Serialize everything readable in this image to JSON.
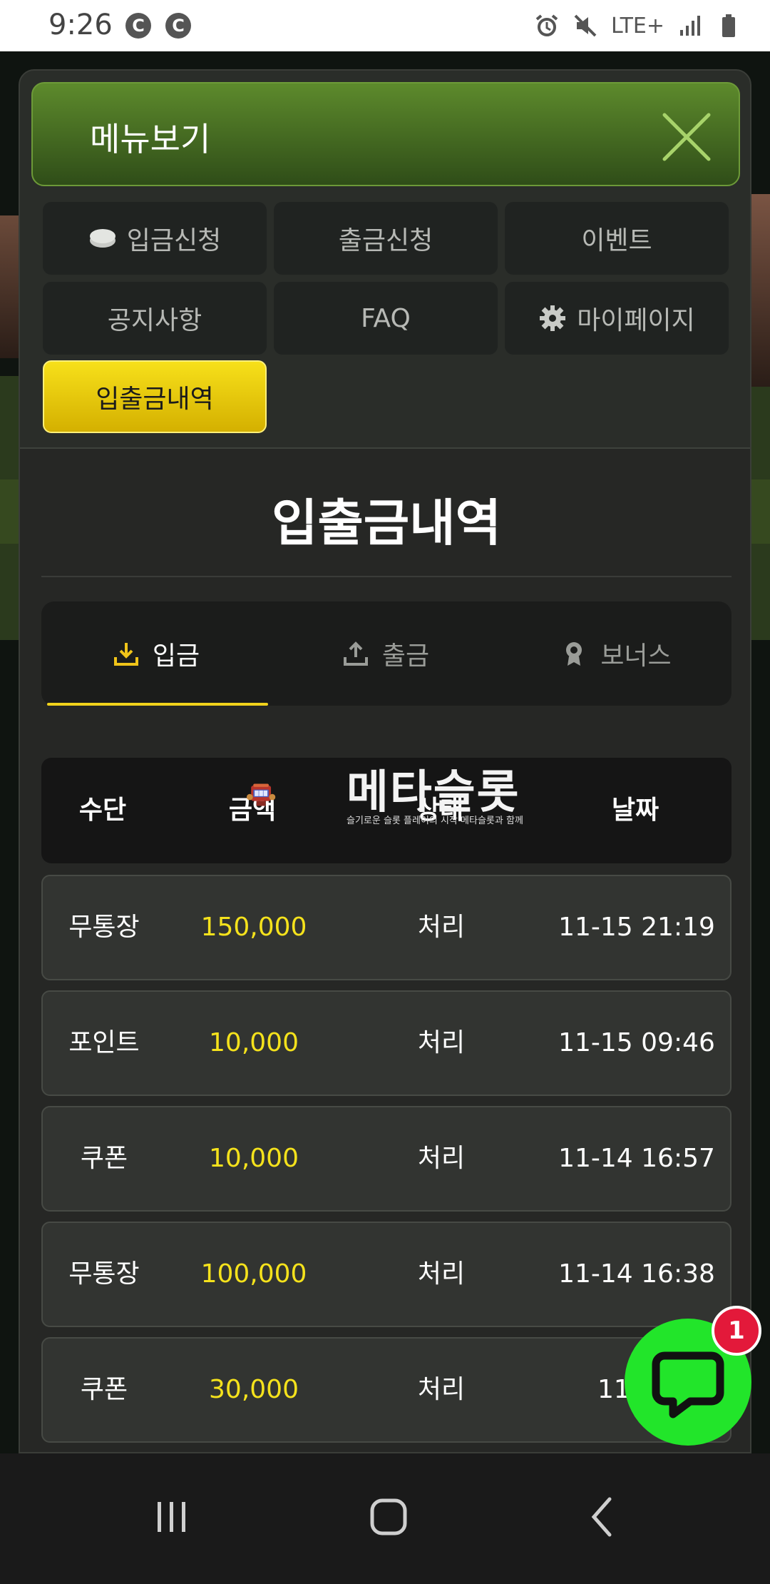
{
  "status_bar": {
    "time": "9:26",
    "notification_icons": [
      "C",
      "C"
    ],
    "network": "LTE+",
    "icons": [
      "alarm-icon",
      "mute-icon",
      "signal-icon",
      "battery-icon"
    ]
  },
  "modal": {
    "title": "메뉴보기",
    "menu": [
      {
        "label": "입금신청",
        "icon": "coin-icon"
      },
      {
        "label": "출금신청",
        "icon": ""
      },
      {
        "label": "이벤트",
        "icon": ""
      },
      {
        "label": "공지사항",
        "icon": ""
      },
      {
        "label": "FAQ",
        "icon": ""
      },
      {
        "label": "마이페이지",
        "icon": "gear-icon"
      },
      {
        "label": "입출금내역",
        "icon": "",
        "active": true
      }
    ],
    "section_title": "입출금내역",
    "tabs": [
      {
        "label": "입금",
        "icon": "download-icon",
        "active": true
      },
      {
        "label": "출금",
        "icon": "upload-icon"
      },
      {
        "label": "보너스",
        "icon": "badge-icon"
      }
    ],
    "table": {
      "headers": [
        "수단",
        "금액",
        "상태",
        "날짜"
      ],
      "rows": [
        {
          "method": "무통장",
          "amount": "150,000",
          "status": "처리",
          "date": "11-15 21:19"
        },
        {
          "method": "포인트",
          "amount": "10,000",
          "status": "처리",
          "date": "11-15 09:46"
        },
        {
          "method": "쿠폰",
          "amount": "10,000",
          "status": "처리",
          "date": "11-14 16:57"
        },
        {
          "method": "무통장",
          "amount": "100,000",
          "status": "처리",
          "date": "11-14 16:38"
        },
        {
          "method": "쿠폰",
          "amount": "30,000",
          "status": "처리",
          "date": "11-14"
        }
      ]
    }
  },
  "watermark": {
    "name": "메타슬롯",
    "tagline": "슬기로운 슬롯 플레이의 시작 메타슬롯과 함께"
  },
  "chat": {
    "badge_count": "1"
  },
  "colors": {
    "accent_yellow": "#f5e21c",
    "header_green": "#4f7a26",
    "chat_green": "#22e52a",
    "badge_red": "#e3193a"
  }
}
